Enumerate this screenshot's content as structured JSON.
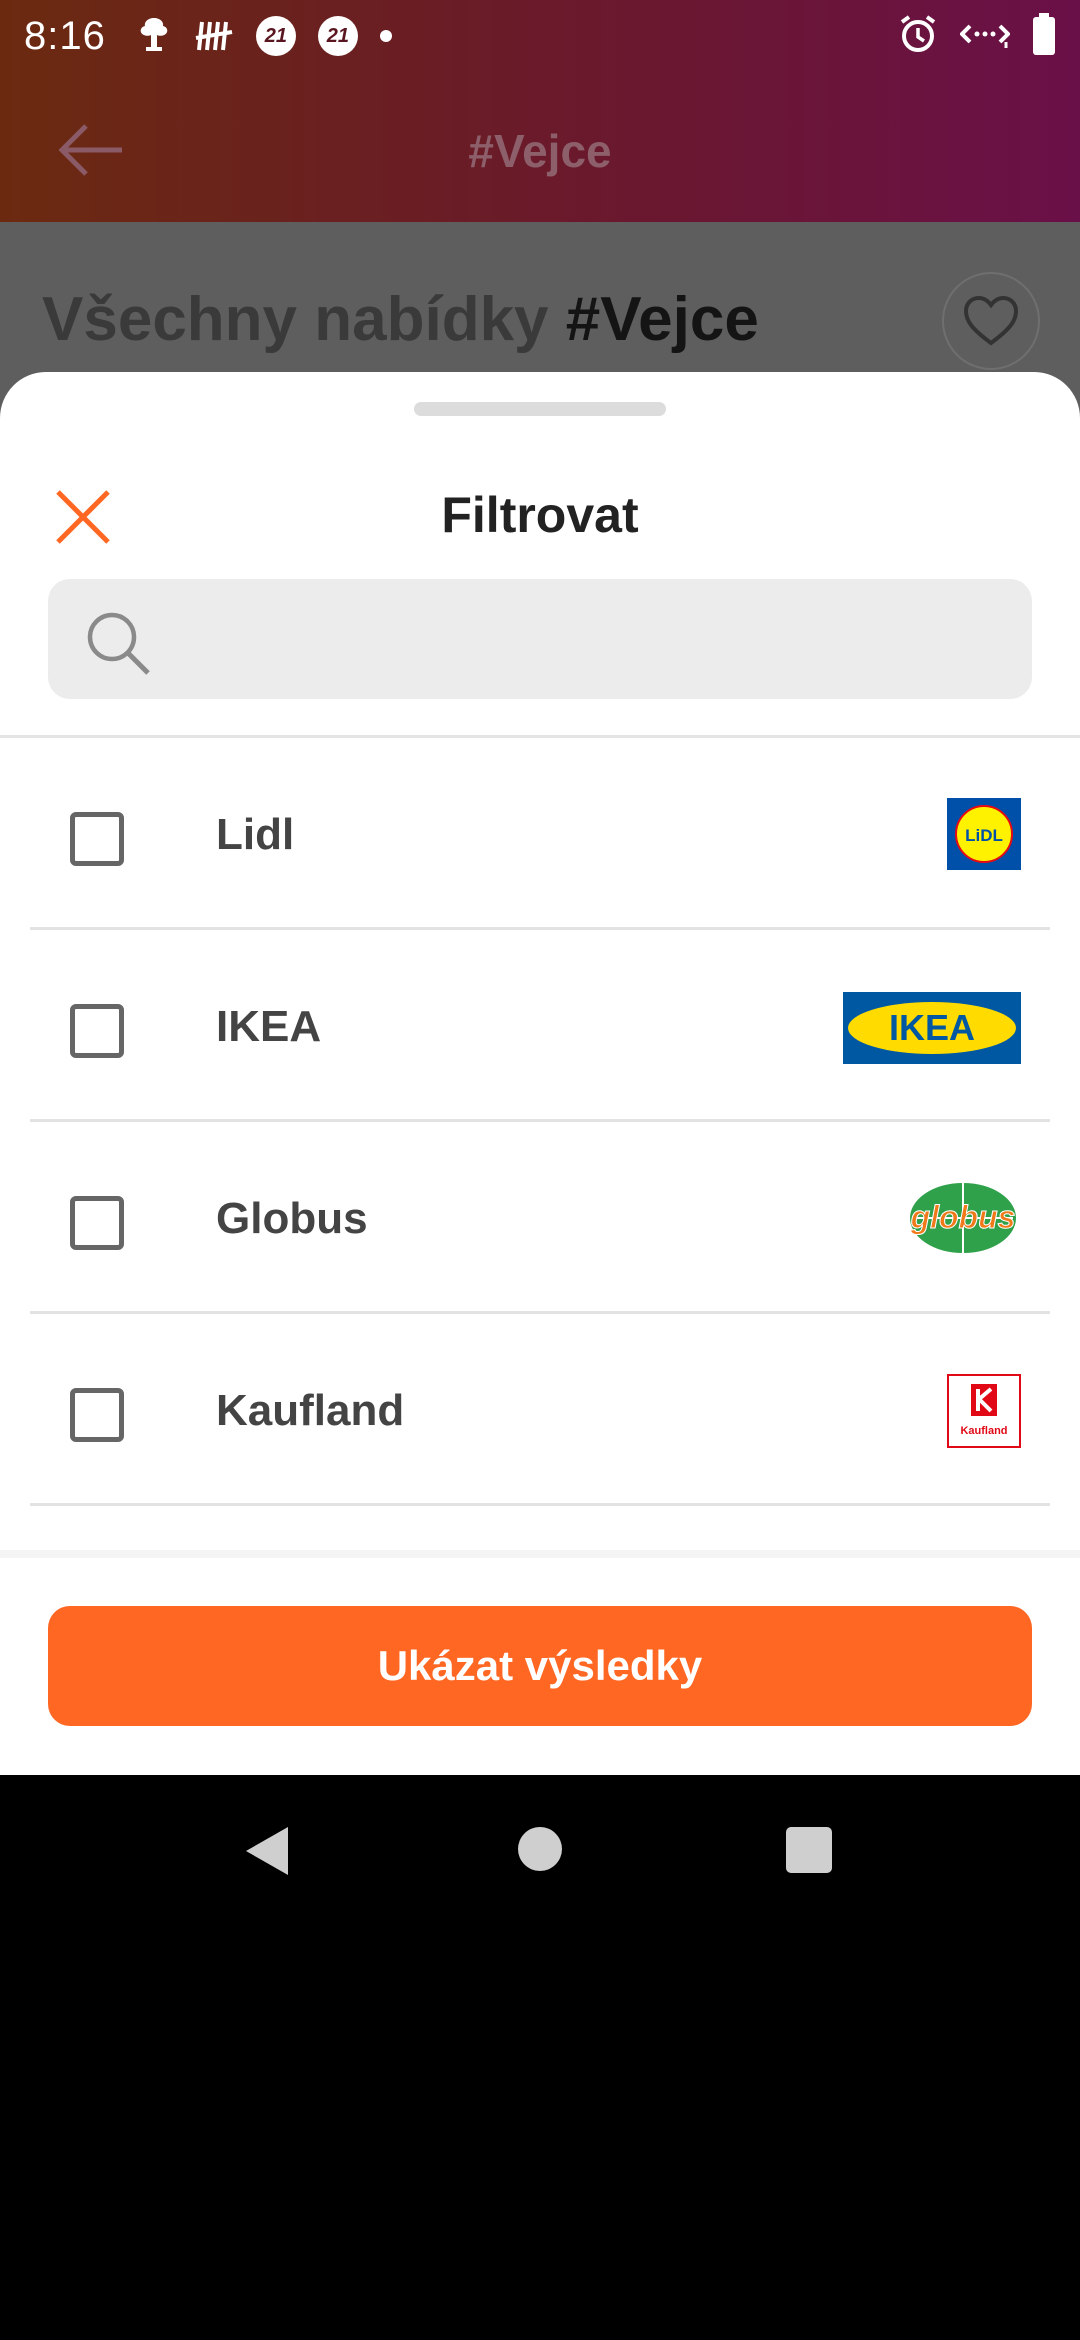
{
  "status_bar": {
    "time": "8:16",
    "badge_1": "21",
    "badge_2": "21"
  },
  "app_bar": {
    "title": "#Vejce"
  },
  "background": {
    "heading_prefix": "Všechny nabídky ",
    "heading_tag": "#Vejce"
  },
  "sheet": {
    "title": "Filtrovat",
    "search": {
      "placeholder": "",
      "value": ""
    },
    "items": [
      {
        "label": "Lidl",
        "logo": "lidl-logo",
        "checked": false
      },
      {
        "label": "IKEA",
        "logo": "ikea-logo",
        "checked": false
      },
      {
        "label": "Globus",
        "logo": "globus-logo",
        "checked": false
      },
      {
        "label": "Kaufland",
        "logo": "kaufland-logo",
        "checked": false
      }
    ],
    "logo_texts": {
      "lidl": "LiDL",
      "ikea": "IKEA",
      "globus": "globus",
      "kaufland": "Kaufland"
    },
    "cta_label": "Ukázat výsledky"
  },
  "colors": {
    "accent": "#ff6723",
    "statusbar_gradient_start": "#6b2a10",
    "statusbar_gradient_end": "#6a1048"
  }
}
